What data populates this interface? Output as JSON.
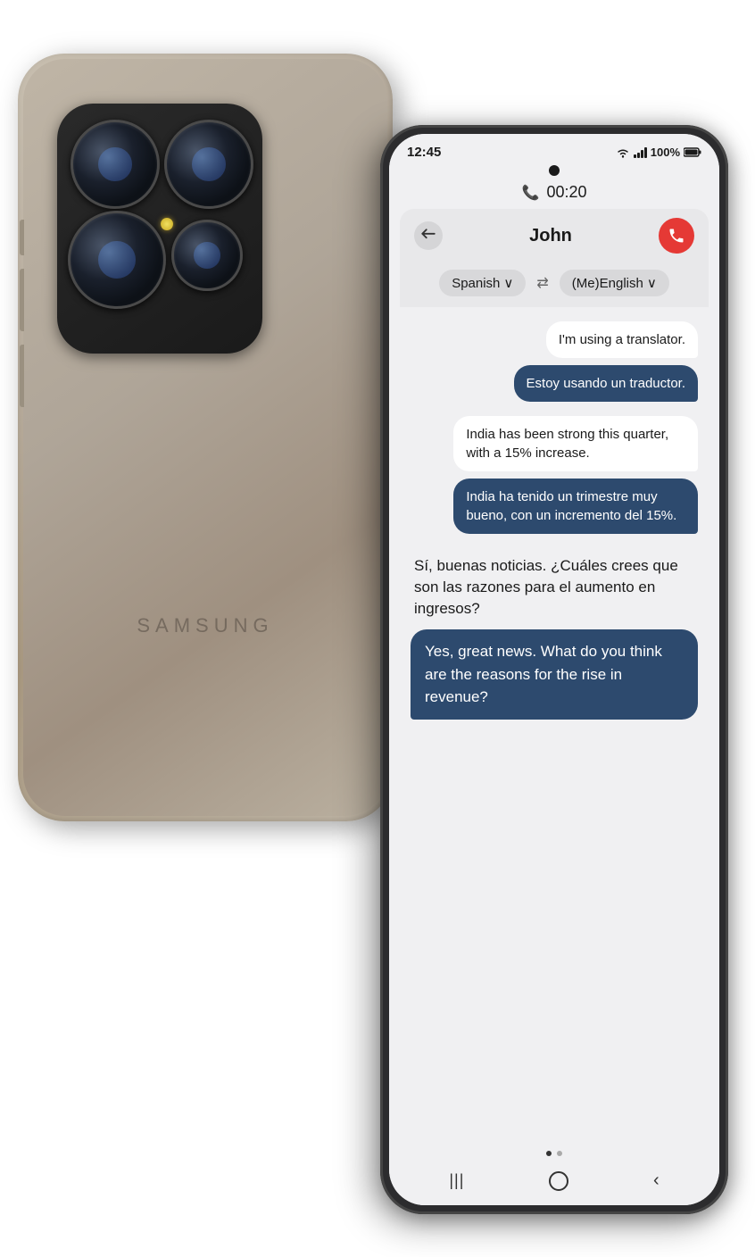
{
  "back_phone": {
    "samsung_label": "SAMSUNG"
  },
  "status_bar": {
    "time": "12:45",
    "wifi": "WiFi",
    "signal": "Signal",
    "battery": "100%"
  },
  "call": {
    "icon": "📞",
    "timer": "00:20"
  },
  "header": {
    "back_label": "⬅",
    "contact_name": "John",
    "end_call_icon": "📞"
  },
  "language_selector": {
    "source_lang": "Spanish",
    "source_chevron": "∨",
    "swap_icon": "⇄",
    "target_lang": "(Me)English",
    "target_chevron": "∨"
  },
  "messages": [
    {
      "text": "I'm using a translator.",
      "style": "light",
      "align": "right"
    },
    {
      "text": "Estoy usando un traductor.",
      "style": "dark",
      "align": "right"
    },
    {
      "text": "India has been strong this quarter, with a 15% increase.",
      "style": "light",
      "align": "right"
    },
    {
      "text": "India ha tenido un trimestre muy bueno, con un incremento del 15%.",
      "style": "dark",
      "align": "right"
    },
    {
      "text": "Sí, buenas noticias. ¿Cuáles crees que son las razones para el aumento en ingresos?",
      "style": "plain",
      "align": "left"
    },
    {
      "text": "Yes, great news. What do you think are the reasons for the rise in revenue?",
      "style": "dark-plain",
      "align": "left"
    }
  ],
  "nav": {
    "back_icon": "|||",
    "home_icon": "○",
    "recent_icon": "<"
  }
}
